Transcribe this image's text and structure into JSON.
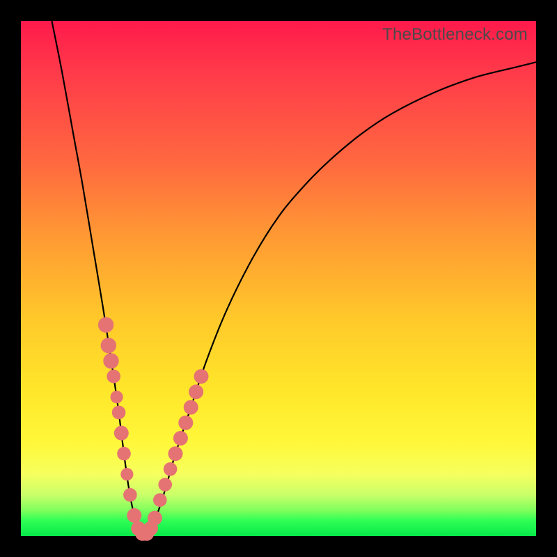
{
  "watermark": "TheBottleneck.com",
  "colors": {
    "frame": "#000000",
    "dot": "#e57373",
    "curve": "#000000",
    "gradient_stops": [
      "#ff1a4b",
      "#ff3a4a",
      "#ff6a3f",
      "#ff9a33",
      "#ffc92a",
      "#ffe72a",
      "#fff83a",
      "#f6ff5e",
      "#c9ff6a",
      "#7fff5c",
      "#2fff55",
      "#07e84a"
    ]
  },
  "chart_data": {
    "type": "line",
    "title": "",
    "xlabel": "",
    "ylabel": "",
    "xlim": [
      0,
      100
    ],
    "ylim": [
      0,
      100
    ],
    "series": [
      {
        "name": "bottleneck-curve",
        "x": [
          6,
          8,
          10,
          12,
          14,
          16,
          18,
          19,
          20,
          21,
          22,
          23,
          24,
          25,
          26,
          28,
          30,
          33,
          36,
          40,
          45,
          50,
          55,
          60,
          66,
          72,
          80,
          88,
          96,
          100
        ],
        "values": [
          100,
          90,
          79,
          68,
          56,
          44,
          31,
          24,
          16,
          9,
          4,
          1,
          0,
          1,
          3,
          9,
          16,
          25,
          34,
          44,
          54,
          62,
          68,
          73,
          78,
          82,
          86,
          89,
          91,
          92
        ]
      }
    ],
    "markers": [
      {
        "x": 16.5,
        "y": 41,
        "r": 1.6
      },
      {
        "x": 17.0,
        "y": 37,
        "r": 1.6
      },
      {
        "x": 17.5,
        "y": 34,
        "r": 1.6
      },
      {
        "x": 18.0,
        "y": 31,
        "r": 1.4
      },
      {
        "x": 18.6,
        "y": 27,
        "r": 1.3
      },
      {
        "x": 19.0,
        "y": 24,
        "r": 1.4
      },
      {
        "x": 19.5,
        "y": 20,
        "r": 1.5
      },
      {
        "x": 20.0,
        "y": 16,
        "r": 1.4
      },
      {
        "x": 20.6,
        "y": 12,
        "r": 1.3
      },
      {
        "x": 21.2,
        "y": 8,
        "r": 1.4
      },
      {
        "x": 22.0,
        "y": 4,
        "r": 1.5
      },
      {
        "x": 22.8,
        "y": 1.5,
        "r": 1.5
      },
      {
        "x": 23.6,
        "y": 0.5,
        "r": 1.5
      },
      {
        "x": 24.4,
        "y": 0.5,
        "r": 1.5
      },
      {
        "x": 25.2,
        "y": 1.5,
        "r": 1.5
      },
      {
        "x": 26.0,
        "y": 3.5,
        "r": 1.5
      },
      {
        "x": 27.0,
        "y": 7,
        "r": 1.4
      },
      {
        "x": 28.0,
        "y": 10,
        "r": 1.4
      },
      {
        "x": 29.0,
        "y": 13,
        "r": 1.4
      },
      {
        "x": 30.0,
        "y": 16,
        "r": 1.5
      },
      {
        "x": 31.0,
        "y": 19,
        "r": 1.5
      },
      {
        "x": 32.0,
        "y": 22,
        "r": 1.5
      },
      {
        "x": 33.0,
        "y": 25,
        "r": 1.5
      },
      {
        "x": 34.0,
        "y": 28,
        "r": 1.5
      },
      {
        "x": 35.0,
        "y": 31,
        "r": 1.5
      }
    ]
  }
}
